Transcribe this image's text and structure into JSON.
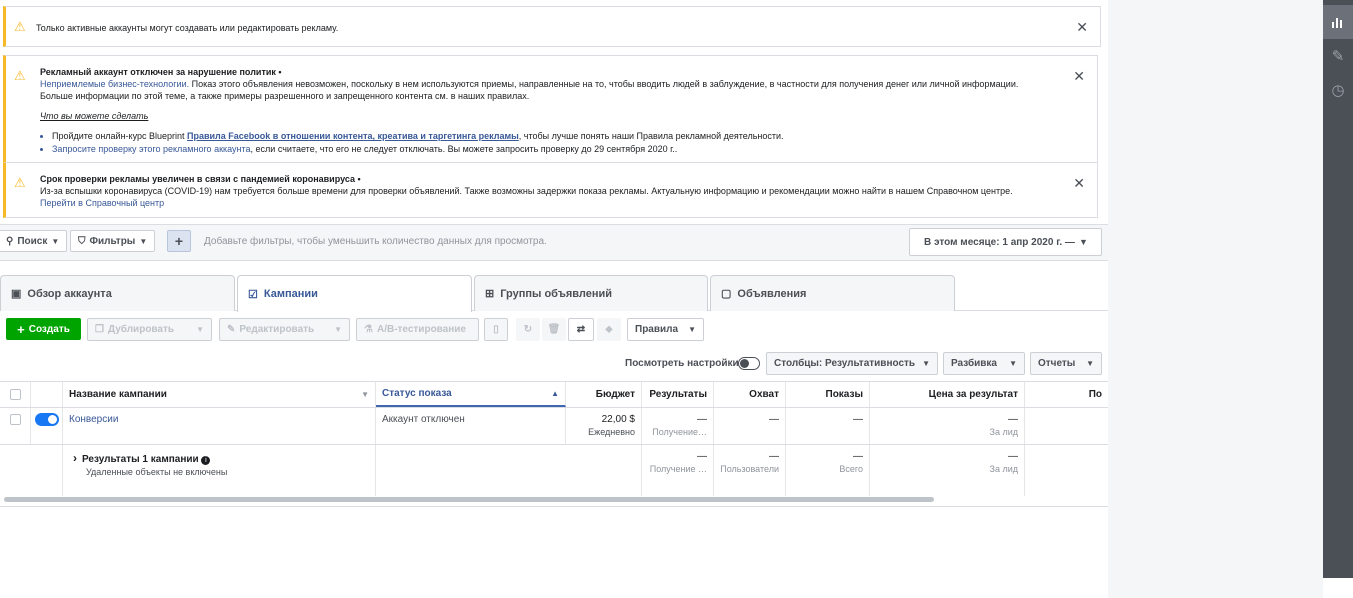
{
  "notices": {
    "inactive": {
      "text": "Только активные аккаунты могут создавать или редактировать рекламу."
    },
    "policy": {
      "title": "Рекламный аккаунт отключен за нарушение политик •",
      "link": "Неприемлемые бизнес-технологии.",
      "body": " Показ этого объявления невозможен, поскольку в нем используются приемы, направленные на то, чтобы вводить людей в заблуждение, в частности для получения денег или личной информации. Больше информации по этой теме, а также примеры разрешенного и запрещенного контента см. в наших правилах.",
      "what_to_do": "Что вы можете сделать",
      "bullet1_prefix": "Пройдите онлайн-курс Blueprint ",
      "bullet1_link": "Правила Facebook в отношении контента, креатива и таргетинга рекламы",
      "bullet1_suffix": ", чтобы лучше понять наши Правила рекламной деятельности.",
      "bullet2_link": "Запросите проверку этого рекламного аккаунта",
      "bullet2_suffix": ", если считаете, что его не следует отключать. Вы можете запросить проверку до 29 сентября 2020 г.."
    },
    "covid": {
      "title": "Срок проверки рекламы увеличен в связи с пандемией коронавируса •",
      "body": "Из-за вспышки коронавируса (COVID-19) нам требуется больше времени для проверки объявлений. Также возможны задержки показа рекламы. Актуальную информацию и рекомендации можно найти в нашем Справочном центре. ",
      "link": "Перейти в Справочный центр"
    }
  },
  "filters": {
    "search": "Поиск",
    "filters": "Фильтры",
    "placeholder": "Добавьте фильтры, чтобы уменьшить количество данных для просмотра.",
    "date": "В этом месяце: 1 апр 2020 г. —"
  },
  "tabs": [
    "Обзор аккаунта",
    "Кампании",
    "Группы объявлений",
    "Объявления"
  ],
  "toolbar": {
    "create": "Создать",
    "duplicate": "Дублировать",
    "edit": "Редактировать",
    "ab": "A/B-тестирование",
    "rules": "Правила",
    "view_settings": "Посмотреть настройки",
    "columns": "Столбцы: Результативность",
    "breakdown": "Разбивка",
    "reports": "Отчеты"
  },
  "table": {
    "headers": [
      "Название кампании",
      "Статус показа",
      "Бюджет",
      "Результаты",
      "Охват",
      "Показы",
      "Цена за результат",
      "По"
    ],
    "row": {
      "name": "Конверсии",
      "status": "Аккаунт отключен",
      "budget": "22,00 $",
      "budget_sub": "Ежедневно",
      "results": "—",
      "results_sub": "Получение…",
      "reach": "—",
      "impressions": "—",
      "cost": "—",
      "cost_sub": "За лид"
    },
    "summary": {
      "title": "Результаты 1 кампании",
      "sub": "Удаленные объекты не включены",
      "results": "—",
      "results_sub": "Получение …",
      "reach": "—",
      "reach_sub": "Пользователи",
      "impressions": "—",
      "impressions_sub": "Всего",
      "cost": "—",
      "cost_sub": "За лид"
    }
  }
}
